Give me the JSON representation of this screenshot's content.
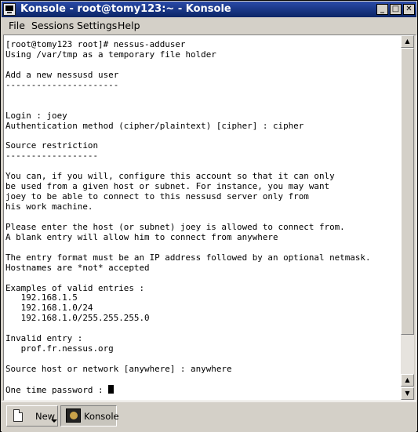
{
  "window": {
    "title": "Konsole - root@tomy123:~ - Konsole",
    "buttons": {
      "minimize": "_",
      "maximize": "□",
      "close": "✕"
    }
  },
  "menubar": {
    "items": [
      "File",
      "Sessions",
      "Settings",
      "Help"
    ]
  },
  "terminal": {
    "lines": [
      "[root@tomy123 root]# nessus-adduser",
      "Using /var/tmp as a temporary file holder",
      "",
      "Add a new nessusd user",
      "----------------------",
      "",
      "",
      "Login : joey",
      "Authentication method (cipher/plaintext) [cipher] : cipher",
      "",
      "Source restriction",
      "------------------",
      "",
      "You can, if you will, configure this account so that it can only",
      "be used from a given host or subnet. For instance, you may want",
      "joey to be able to connect to this nessusd server only from",
      "his work machine.",
      "",
      "Please enter the host (or subnet) joey is allowed to connect from.",
      "A blank entry will allow him to connect from anywhere",
      "",
      "The entry format must be an IP address followed by an optional netmask.",
      "Hostnames are *not* accepted",
      "",
      "Examples of valid entries :",
      "   192.168.1.5",
      "   192.168.1.0/24",
      "   192.168.1.0/255.255.255.0",
      "",
      "Invalid entry :",
      "   prof.fr.nessus.org",
      "",
      "Source host or network [anywhere] : anywhere",
      "",
      "One time password : "
    ]
  },
  "scrollbar": {
    "up_arrow": "▲",
    "down_arrow": "▼",
    "icons": [
      "arrow-up-icon",
      "arrow-down-icon"
    ]
  },
  "tabbar": {
    "new_label": "New",
    "session_label": "Konsole",
    "icons": [
      "new-document-icon",
      "konsole-shell-icon"
    ]
  }
}
